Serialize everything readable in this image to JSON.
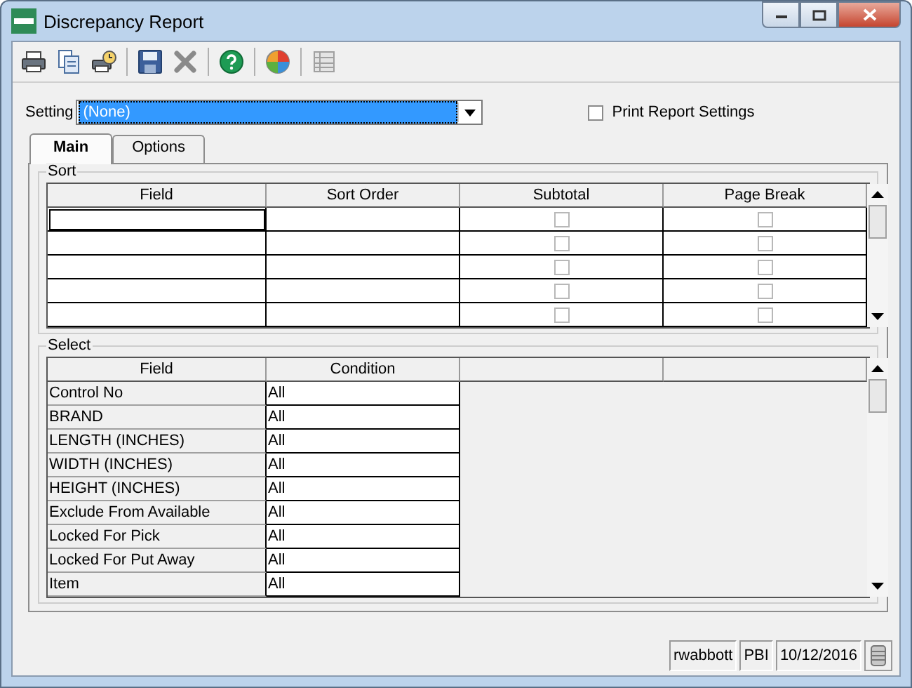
{
  "window": {
    "title": "Discrepancy Report"
  },
  "setting": {
    "label": "Setting",
    "value": "(None)"
  },
  "print_report_settings": {
    "label": "Print Report Settings",
    "checked": false
  },
  "tabs": [
    {
      "label": "Main",
      "selected": true
    },
    {
      "label": "Options",
      "selected": false
    }
  ],
  "sort": {
    "title": "Sort",
    "columns": [
      "Field",
      "Sort Order",
      "Subtotal",
      "Page Break"
    ],
    "rows": [
      {
        "subtotal": false,
        "page_break": false
      },
      {
        "subtotal": false,
        "page_break": false
      },
      {
        "subtotal": false,
        "page_break": false
      },
      {
        "subtotal": false,
        "page_break": false
      },
      {
        "subtotal": false,
        "page_break": false
      }
    ]
  },
  "select": {
    "title": "Select",
    "columns": [
      "Field",
      "Condition"
    ],
    "rows": [
      {
        "field": "Control No",
        "condition": "All"
      },
      {
        "field": "BRAND",
        "condition": "All"
      },
      {
        "field": "LENGTH (INCHES)",
        "condition": "All"
      },
      {
        "field": "WIDTH (INCHES)",
        "condition": "All"
      },
      {
        "field": "HEIGHT (INCHES)",
        "condition": "All"
      },
      {
        "field": "Exclude From Available",
        "condition": "All"
      },
      {
        "field": "Locked For Pick",
        "condition": "All"
      },
      {
        "field": "Locked For Put Away",
        "condition": "All"
      },
      {
        "field": "Item",
        "condition": "All"
      }
    ]
  },
  "status_bar": [
    "rwabbott",
    "PBI",
    "10/12/2016"
  ]
}
